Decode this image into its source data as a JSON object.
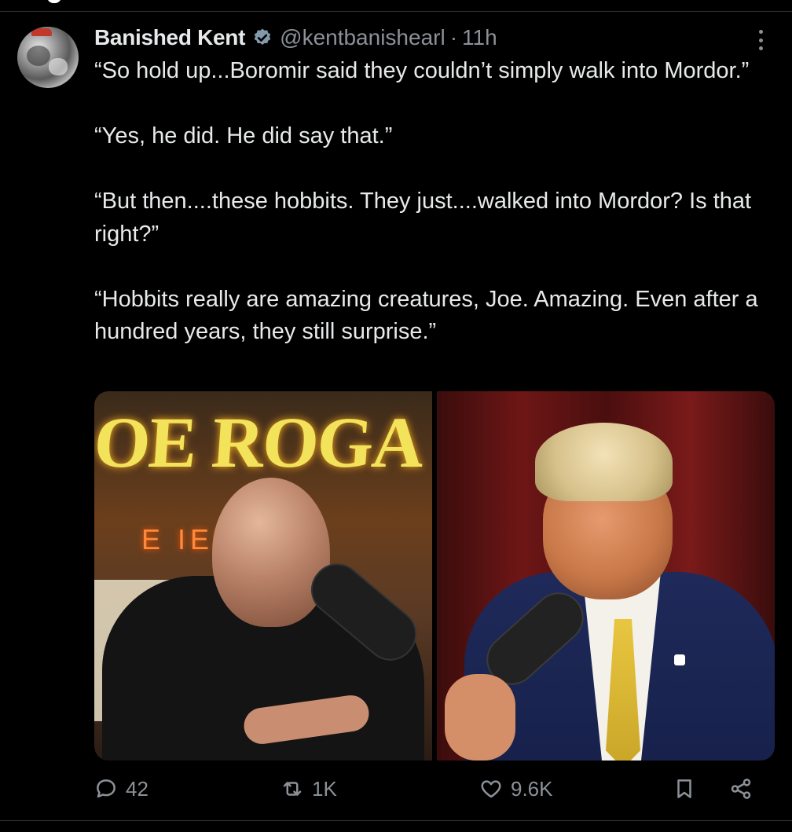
{
  "post": {
    "author_name": "Banished Kent",
    "handle": "@kentbanishearl",
    "separator": "·",
    "time": "11h",
    "paragraphs": [
      "“So hold up...Boromir said they couldn’t simply walk into Mordor.”",
      "“Yes, he did. He did say that.”",
      "“But then....these hobbits. They just....walked into Mordor? Is that right?”",
      "“Hobbits really are amazing creatures, Joe. Amazing. Even after a hundred years, they still surprise.”"
    ],
    "media": {
      "left_sign_text": "OE ROGA",
      "left_sign_sub": "E  IENC"
    }
  },
  "actions": {
    "replies": "42",
    "reposts": "1K",
    "likes": "9.6K"
  },
  "icons": {
    "verified": "verified-badge-icon",
    "more": "more-icon",
    "reply": "reply-icon",
    "repost": "repost-icon",
    "like": "heart-icon",
    "bookmark": "bookmark-icon",
    "share": "share-icon"
  },
  "colors": {
    "background": "#000000",
    "text": "#e7e9ea",
    "secondary": "#8b9197",
    "verified": "#829aab",
    "divider": "#2f3336"
  }
}
